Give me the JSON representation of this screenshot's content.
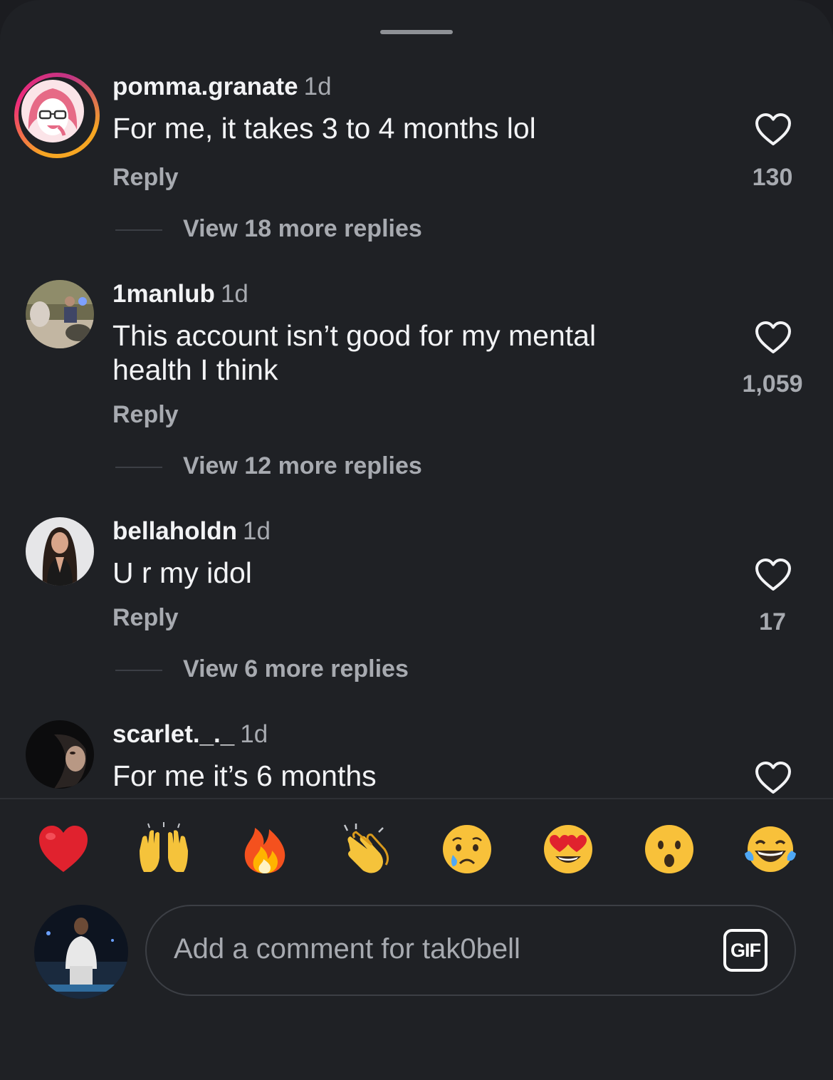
{
  "comments": [
    {
      "username": "pomma.granate",
      "time": "1d",
      "text": "For me, it takes 3 to 4 months lol",
      "reply_label": "Reply",
      "likes": "130",
      "view_replies": "View 18 more replies"
    },
    {
      "username": "1manlub",
      "time": "1d",
      "text": "This account isn’t good for my mental health I think",
      "reply_label": "Reply",
      "likes": "1,059",
      "view_replies": "View 12 more replies"
    },
    {
      "username": "bellaholdn",
      "time": "1d",
      "text": "U r my idol",
      "reply_label": "Reply",
      "likes": "17",
      "view_replies": "View 6 more replies"
    },
    {
      "username": "scarlet._._",
      "time": "1d",
      "text": "For me it’s 6 months"
    }
  ],
  "quick_reactions": [
    "❤️",
    "🙌",
    "🔥",
    "👏",
    "😢",
    "😍",
    "😮",
    "😂"
  ],
  "composer": {
    "placeholder": "Add a comment for tak0bell",
    "gif_label": "GIF"
  },
  "colors": {
    "background": "#1f2125",
    "text_primary": "#f2f3f5",
    "text_secondary": "#a7aab0",
    "story_ring": [
      "#f6a623",
      "#ee2a7b",
      "#c13584"
    ]
  }
}
